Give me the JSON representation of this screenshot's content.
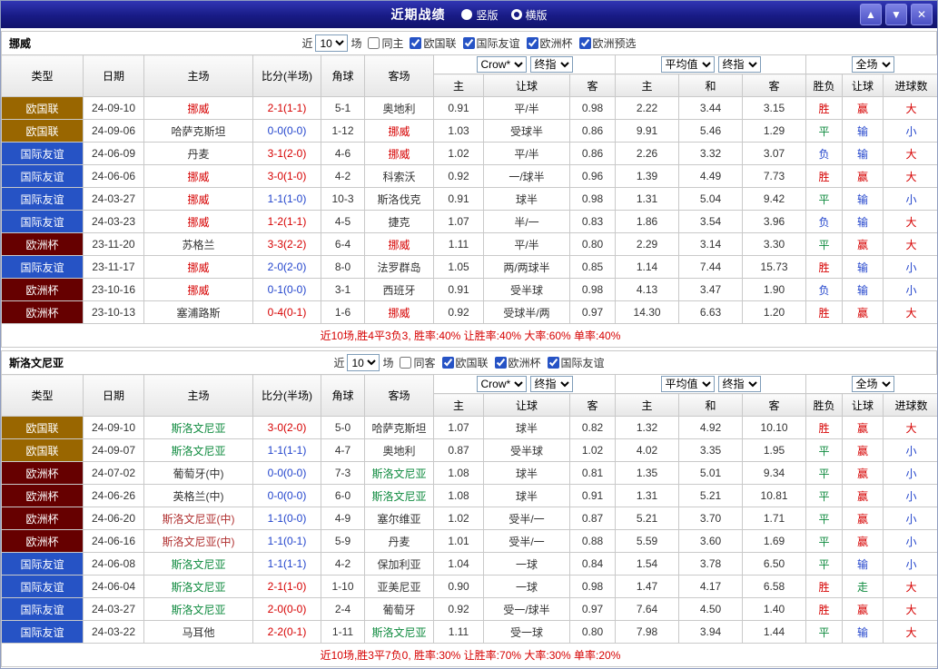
{
  "colors": {
    "red": "#d60000",
    "blue": "#2244cc",
    "green": "#0e8a3e",
    "dark": "#333333",
    "maroon": "#b03030",
    "titlebar": "#181b85"
  },
  "type_colors": {
    "欧国联": "#996600",
    "国际友谊": "#2653c5",
    "欧洲杯": "#660000"
  },
  "header": {
    "title": "近期战绩",
    "radios": [
      {
        "label": "竖版",
        "selected": false
      },
      {
        "label": "横版",
        "selected": true
      }
    ],
    "buttons": [
      {
        "name": "move-up",
        "icon": "arrow-up-icon",
        "glyph": "▲"
      },
      {
        "name": "move-down",
        "icon": "arrow-down-icon",
        "glyph": "▼"
      },
      {
        "name": "close",
        "icon": "close-icon",
        "glyph": "✕"
      }
    ]
  },
  "table_controls": {
    "near_label": "近",
    "count_value": "10",
    "games_label": "场",
    "company_dropdown": "Crow*",
    "final_odds_dropdown": "终指",
    "average_dropdown": "平均值",
    "final_odds_dropdown2": "终指",
    "scope_dropdown": "全场"
  },
  "columns": [
    "类型",
    "日期",
    "主场",
    "比分(半场)",
    "角球",
    "客场",
    "主",
    "让球",
    "客",
    "主",
    "和",
    "客",
    "胜负",
    "让球",
    "进球数"
  ],
  "sections": [
    {
      "team": "挪威",
      "same_venue_label": "同主",
      "filters": [
        "欧国联",
        "国际友谊",
        "欧洲杯",
        "欧洲预选"
      ],
      "summary": "近10场,胜4平3负3, 胜率:40% 让胜率:40% 大率:60% 单率:40%",
      "rows": [
        {
          "type": "欧国联",
          "date": "24-09-10",
          "home": "挪威",
          "home_c": "red",
          "score": "2-1(1-1)",
          "score_c": "red",
          "corner": "5-1",
          "away": "奥地利",
          "away_c": "dark",
          "odds": [
            "0.91",
            "平/半",
            "0.98"
          ],
          "avg": [
            "2.22",
            "3.44",
            "3.15"
          ],
          "result": "胜",
          "result_c": "red",
          "cover": "赢",
          "cover_c": "red",
          "ou": "大",
          "ou_c": "red"
        },
        {
          "type": "欧国联",
          "date": "24-09-06",
          "home": "哈萨克斯坦",
          "home_c": "dark",
          "score": "0-0(0-0)",
          "score_c": "blue",
          "corner": "1-12",
          "away": "挪威",
          "away_c": "red",
          "odds": [
            "1.03",
            "受球半",
            "0.86"
          ],
          "avg": [
            "9.91",
            "5.46",
            "1.29"
          ],
          "result": "平",
          "result_c": "green",
          "cover": "输",
          "cover_c": "blue",
          "ou": "小",
          "ou_c": "blue"
        },
        {
          "type": "国际友谊",
          "date": "24-06-09",
          "home": "丹麦",
          "home_c": "dark",
          "score": "3-1(2-0)",
          "score_c": "red",
          "corner": "4-6",
          "away": "挪威",
          "away_c": "red",
          "odds": [
            "1.02",
            "平/半",
            "0.86"
          ],
          "avg": [
            "2.26",
            "3.32",
            "3.07"
          ],
          "result": "负",
          "result_c": "blue",
          "cover": "输",
          "cover_c": "blue",
          "ou": "大",
          "ou_c": "red"
        },
        {
          "type": "国际友谊",
          "date": "24-06-06",
          "home": "挪威",
          "home_c": "red",
          "score": "3-0(1-0)",
          "score_c": "red",
          "corner": "4-2",
          "away": "科索沃",
          "away_c": "dark",
          "odds": [
            "0.92",
            "一/球半",
            "0.96"
          ],
          "avg": [
            "1.39",
            "4.49",
            "7.73"
          ],
          "result": "胜",
          "result_c": "red",
          "cover": "赢",
          "cover_c": "red",
          "ou": "大",
          "ou_c": "red"
        },
        {
          "type": "国际友谊",
          "date": "24-03-27",
          "home": "挪威",
          "home_c": "red",
          "score": "1-1(1-0)",
          "score_c": "blue",
          "corner": "10-3",
          "away": "斯洛伐克",
          "away_c": "dark",
          "odds": [
            "0.91",
            "球半",
            "0.98"
          ],
          "avg": [
            "1.31",
            "5.04",
            "9.42"
          ],
          "result": "平",
          "result_c": "green",
          "cover": "输",
          "cover_c": "blue",
          "ou": "小",
          "ou_c": "blue"
        },
        {
          "type": "国际友谊",
          "date": "24-03-23",
          "home": "挪威",
          "home_c": "red",
          "score": "1-2(1-1)",
          "score_c": "red",
          "corner": "4-5",
          "away": "捷克",
          "away_c": "dark",
          "odds": [
            "1.07",
            "半/一",
            "0.83"
          ],
          "avg": [
            "1.86",
            "3.54",
            "3.96"
          ],
          "result": "负",
          "result_c": "blue",
          "cover": "输",
          "cover_c": "blue",
          "ou": "大",
          "ou_c": "red"
        },
        {
          "type": "欧洲杯",
          "date": "23-11-20",
          "home": "苏格兰",
          "home_c": "dark",
          "score": "3-3(2-2)",
          "score_c": "red",
          "corner": "6-4",
          "away": "挪威",
          "away_c": "red",
          "odds": [
            "1.11",
            "平/半",
            "0.80"
          ],
          "avg": [
            "2.29",
            "3.14",
            "3.30"
          ],
          "result": "平",
          "result_c": "green",
          "cover": "赢",
          "cover_c": "red",
          "ou": "大",
          "ou_c": "red"
        },
        {
          "type": "国际友谊",
          "date": "23-11-17",
          "home": "挪威",
          "home_c": "red",
          "score": "2-0(2-0)",
          "score_c": "blue",
          "corner": "8-0",
          "away": "法罗群岛",
          "away_c": "dark",
          "odds": [
            "1.05",
            "两/两球半",
            "0.85"
          ],
          "avg": [
            "1.14",
            "7.44",
            "15.73"
          ],
          "result": "胜",
          "result_c": "red",
          "cover": "输",
          "cover_c": "blue",
          "ou": "小",
          "ou_c": "blue"
        },
        {
          "type": "欧洲杯",
          "date": "23-10-16",
          "home": "挪威",
          "home_c": "red",
          "score": "0-1(0-0)",
          "score_c": "blue",
          "corner": "3-1",
          "away": "西班牙",
          "away_c": "dark",
          "odds": [
            "0.91",
            "受半球",
            "0.98"
          ],
          "avg": [
            "4.13",
            "3.47",
            "1.90"
          ],
          "result": "负",
          "result_c": "blue",
          "cover": "输",
          "cover_c": "blue",
          "ou": "小",
          "ou_c": "blue"
        },
        {
          "type": "欧洲杯",
          "date": "23-10-13",
          "home": "塞浦路斯",
          "home_c": "dark",
          "score": "0-4(0-1)",
          "score_c": "red",
          "corner": "1-6",
          "away": "挪威",
          "away_c": "red",
          "odds": [
            "0.92",
            "受球半/两",
            "0.97"
          ],
          "avg": [
            "14.30",
            "6.63",
            "1.20"
          ],
          "result": "胜",
          "result_c": "red",
          "cover": "赢",
          "cover_c": "red",
          "ou": "大",
          "ou_c": "red"
        }
      ]
    },
    {
      "team": "斯洛文尼亚",
      "same_venue_label": "同客",
      "filters": [
        "欧国联",
        "欧洲杯",
        "国际友谊"
      ],
      "summary": "近10场,胜3平7负0, 胜率:30% 让胜率:70% 大率:30% 单率:20%",
      "rows": [
        {
          "type": "欧国联",
          "date": "24-09-10",
          "home": "斯洛文尼亚",
          "home_c": "green",
          "score": "3-0(2-0)",
          "score_c": "red",
          "corner": "5-0",
          "away": "哈萨克斯坦",
          "away_c": "dark",
          "odds": [
            "1.07",
            "球半",
            "0.82"
          ],
          "avg": [
            "1.32",
            "4.92",
            "10.10"
          ],
          "result": "胜",
          "result_c": "red",
          "cover": "赢",
          "cover_c": "red",
          "ou": "大",
          "ou_c": "red"
        },
        {
          "type": "欧国联",
          "date": "24-09-07",
          "home": "斯洛文尼亚",
          "home_c": "green",
          "score": "1-1(1-1)",
          "score_c": "blue",
          "corner": "4-7",
          "away": "奥地利",
          "away_c": "dark",
          "odds": [
            "0.87",
            "受半球",
            "1.02"
          ],
          "avg": [
            "4.02",
            "3.35",
            "1.95"
          ],
          "result": "平",
          "result_c": "green",
          "cover": "赢",
          "cover_c": "red",
          "ou": "小",
          "ou_c": "blue"
        },
        {
          "type": "欧洲杯",
          "date": "24-07-02",
          "home": "葡萄牙(中)",
          "home_c": "dark",
          "score": "0-0(0-0)",
          "score_c": "blue",
          "corner": "7-3",
          "away": "斯洛文尼亚",
          "away_c": "green",
          "odds": [
            "1.08",
            "球半",
            "0.81"
          ],
          "avg": [
            "1.35",
            "5.01",
            "9.34"
          ],
          "result": "平",
          "result_c": "green",
          "cover": "赢",
          "cover_c": "red",
          "ou": "小",
          "ou_c": "blue"
        },
        {
          "type": "欧洲杯",
          "date": "24-06-26",
          "home": "英格兰(中)",
          "home_c": "dark",
          "score": "0-0(0-0)",
          "score_c": "blue",
          "corner": "6-0",
          "away": "斯洛文尼亚",
          "away_c": "green",
          "odds": [
            "1.08",
            "球半",
            "0.91"
          ],
          "avg": [
            "1.31",
            "5.21",
            "10.81"
          ],
          "result": "平",
          "result_c": "green",
          "cover": "赢",
          "cover_c": "red",
          "ou": "小",
          "ou_c": "blue"
        },
        {
          "type": "欧洲杯",
          "date": "24-06-20",
          "home": "斯洛文尼亚(中)",
          "home_c": "maroon",
          "score": "1-1(0-0)",
          "score_c": "blue",
          "corner": "4-9",
          "away": "塞尔维亚",
          "away_c": "dark",
          "odds": [
            "1.02",
            "受半/一",
            "0.87"
          ],
          "avg": [
            "5.21",
            "3.70",
            "1.71"
          ],
          "result": "平",
          "result_c": "green",
          "cover": "赢",
          "cover_c": "red",
          "ou": "小",
          "ou_c": "blue"
        },
        {
          "type": "欧洲杯",
          "date": "24-06-16",
          "home": "斯洛文尼亚(中)",
          "home_c": "maroon",
          "score": "1-1(0-1)",
          "score_c": "blue",
          "corner": "5-9",
          "away": "丹麦",
          "away_c": "dark",
          "odds": [
            "1.01",
            "受半/一",
            "0.88"
          ],
          "avg": [
            "5.59",
            "3.60",
            "1.69"
          ],
          "result": "平",
          "result_c": "green",
          "cover": "赢",
          "cover_c": "red",
          "ou": "小",
          "ou_c": "blue"
        },
        {
          "type": "国际友谊",
          "date": "24-06-08",
          "home": "斯洛文尼亚",
          "home_c": "green",
          "score": "1-1(1-1)",
          "score_c": "blue",
          "corner": "4-2",
          "away": "保加利亚",
          "away_c": "dark",
          "odds": [
            "1.04",
            "一球",
            "0.84"
          ],
          "avg": [
            "1.54",
            "3.78",
            "6.50"
          ],
          "result": "平",
          "result_c": "green",
          "cover": "输",
          "cover_c": "blue",
          "ou": "小",
          "ou_c": "blue"
        },
        {
          "type": "国际友谊",
          "date": "24-06-04",
          "home": "斯洛文尼亚",
          "home_c": "green",
          "score": "2-1(1-0)",
          "score_c": "red",
          "corner": "1-10",
          "away": "亚美尼亚",
          "away_c": "dark",
          "odds": [
            "0.90",
            "一球",
            "0.98"
          ],
          "avg": [
            "1.47",
            "4.17",
            "6.58"
          ],
          "result": "胜",
          "result_c": "red",
          "cover": "走",
          "cover_c": "green",
          "ou": "大",
          "ou_c": "red"
        },
        {
          "type": "国际友谊",
          "date": "24-03-27",
          "home": "斯洛文尼亚",
          "home_c": "green",
          "score": "2-0(0-0)",
          "score_c": "red",
          "corner": "2-4",
          "away": "葡萄牙",
          "away_c": "dark",
          "odds": [
            "0.92",
            "受一/球半",
            "0.97"
          ],
          "avg": [
            "7.64",
            "4.50",
            "1.40"
          ],
          "result": "胜",
          "result_c": "red",
          "cover": "赢",
          "cover_c": "red",
          "ou": "大",
          "ou_c": "red"
        },
        {
          "type": "国际友谊",
          "date": "24-03-22",
          "home": "马耳他",
          "home_c": "dark",
          "score": "2-2(0-1)",
          "score_c": "red",
          "corner": "1-11",
          "away": "斯洛文尼亚",
          "away_c": "green",
          "odds": [
            "1.11",
            "受一球",
            "0.80"
          ],
          "avg": [
            "7.98",
            "3.94",
            "1.44"
          ],
          "result": "平",
          "result_c": "green",
          "cover": "输",
          "cover_c": "blue",
          "ou": "大",
          "ou_c": "red"
        }
      ]
    }
  ]
}
